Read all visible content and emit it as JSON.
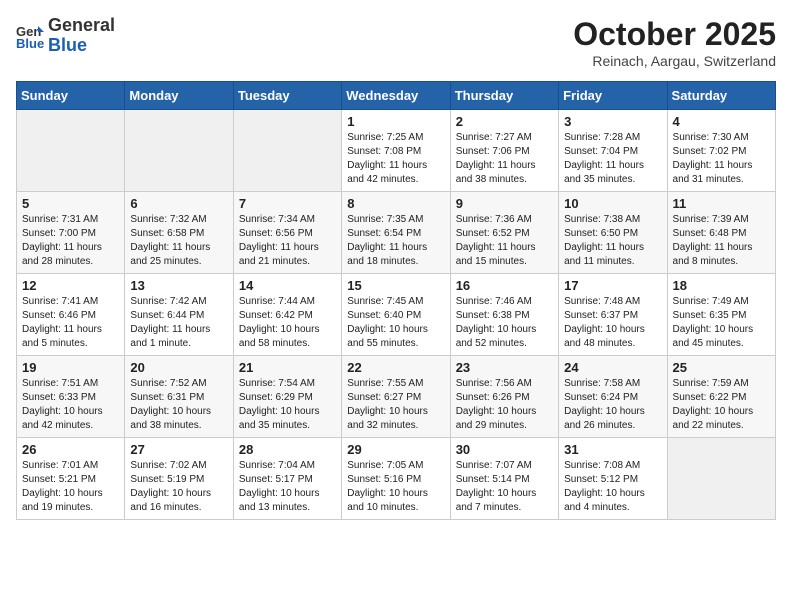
{
  "header": {
    "logo_general": "General",
    "logo_blue": "Blue",
    "month_title": "October 2025",
    "location": "Reinach, Aargau, Switzerland"
  },
  "weekdays": [
    "Sunday",
    "Monday",
    "Tuesday",
    "Wednesday",
    "Thursday",
    "Friday",
    "Saturday"
  ],
  "weeks": [
    [
      null,
      null,
      null,
      {
        "day": "1",
        "sunrise": "7:25 AM",
        "sunset": "7:08 PM",
        "daylight": "11 hours and 42 minutes."
      },
      {
        "day": "2",
        "sunrise": "7:27 AM",
        "sunset": "7:06 PM",
        "daylight": "11 hours and 38 minutes."
      },
      {
        "day": "3",
        "sunrise": "7:28 AM",
        "sunset": "7:04 PM",
        "daylight": "11 hours and 35 minutes."
      },
      {
        "day": "4",
        "sunrise": "7:30 AM",
        "sunset": "7:02 PM",
        "daylight": "11 hours and 31 minutes."
      }
    ],
    [
      {
        "day": "5",
        "sunrise": "7:31 AM",
        "sunset": "7:00 PM",
        "daylight": "11 hours and 28 minutes."
      },
      {
        "day": "6",
        "sunrise": "7:32 AM",
        "sunset": "6:58 PM",
        "daylight": "11 hours and 25 minutes."
      },
      {
        "day": "7",
        "sunrise": "7:34 AM",
        "sunset": "6:56 PM",
        "daylight": "11 hours and 21 minutes."
      },
      {
        "day": "8",
        "sunrise": "7:35 AM",
        "sunset": "6:54 PM",
        "daylight": "11 hours and 18 minutes."
      },
      {
        "day": "9",
        "sunrise": "7:36 AM",
        "sunset": "6:52 PM",
        "daylight": "11 hours and 15 minutes."
      },
      {
        "day": "10",
        "sunrise": "7:38 AM",
        "sunset": "6:50 PM",
        "daylight": "11 hours and 11 minutes."
      },
      {
        "day": "11",
        "sunrise": "7:39 AM",
        "sunset": "6:48 PM",
        "daylight": "11 hours and 8 minutes."
      }
    ],
    [
      {
        "day": "12",
        "sunrise": "7:41 AM",
        "sunset": "6:46 PM",
        "daylight": "11 hours and 5 minutes."
      },
      {
        "day": "13",
        "sunrise": "7:42 AM",
        "sunset": "6:44 PM",
        "daylight": "11 hours and 1 minute."
      },
      {
        "day": "14",
        "sunrise": "7:44 AM",
        "sunset": "6:42 PM",
        "daylight": "10 hours and 58 minutes."
      },
      {
        "day": "15",
        "sunrise": "7:45 AM",
        "sunset": "6:40 PM",
        "daylight": "10 hours and 55 minutes."
      },
      {
        "day": "16",
        "sunrise": "7:46 AM",
        "sunset": "6:38 PM",
        "daylight": "10 hours and 52 minutes."
      },
      {
        "day": "17",
        "sunrise": "7:48 AM",
        "sunset": "6:37 PM",
        "daylight": "10 hours and 48 minutes."
      },
      {
        "day": "18",
        "sunrise": "7:49 AM",
        "sunset": "6:35 PM",
        "daylight": "10 hours and 45 minutes."
      }
    ],
    [
      {
        "day": "19",
        "sunrise": "7:51 AM",
        "sunset": "6:33 PM",
        "daylight": "10 hours and 42 minutes."
      },
      {
        "day": "20",
        "sunrise": "7:52 AM",
        "sunset": "6:31 PM",
        "daylight": "10 hours and 38 minutes."
      },
      {
        "day": "21",
        "sunrise": "7:54 AM",
        "sunset": "6:29 PM",
        "daylight": "10 hours and 35 minutes."
      },
      {
        "day": "22",
        "sunrise": "7:55 AM",
        "sunset": "6:27 PM",
        "daylight": "10 hours and 32 minutes."
      },
      {
        "day": "23",
        "sunrise": "7:56 AM",
        "sunset": "6:26 PM",
        "daylight": "10 hours and 29 minutes."
      },
      {
        "day": "24",
        "sunrise": "7:58 AM",
        "sunset": "6:24 PM",
        "daylight": "10 hours and 26 minutes."
      },
      {
        "day": "25",
        "sunrise": "7:59 AM",
        "sunset": "6:22 PM",
        "daylight": "10 hours and 22 minutes."
      }
    ],
    [
      {
        "day": "26",
        "sunrise": "7:01 AM",
        "sunset": "5:21 PM",
        "daylight": "10 hours and 19 minutes."
      },
      {
        "day": "27",
        "sunrise": "7:02 AM",
        "sunset": "5:19 PM",
        "daylight": "10 hours and 16 minutes."
      },
      {
        "day": "28",
        "sunrise": "7:04 AM",
        "sunset": "5:17 PM",
        "daylight": "10 hours and 13 minutes."
      },
      {
        "day": "29",
        "sunrise": "7:05 AM",
        "sunset": "5:16 PM",
        "daylight": "10 hours and 10 minutes."
      },
      {
        "day": "30",
        "sunrise": "7:07 AM",
        "sunset": "5:14 PM",
        "daylight": "10 hours and 7 minutes."
      },
      {
        "day": "31",
        "sunrise": "7:08 AM",
        "sunset": "5:12 PM",
        "daylight": "10 hours and 4 minutes."
      },
      null
    ]
  ]
}
